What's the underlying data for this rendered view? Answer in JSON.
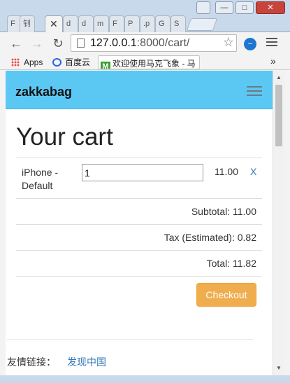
{
  "browser": {
    "tabs": [
      "F",
      "钊",
      "",
      "d",
      "d",
      "m",
      "F",
      "P",
      ".p",
      "G",
      "S"
    ],
    "address_host": "127.0.0.1",
    "address_rest": ":8000/cart/",
    "window_buttons": {
      "minimize": "—",
      "maximize": "□",
      "close": "✕"
    },
    "bookmarks": {
      "apps_label": "Apps",
      "baidu_label": "百度云",
      "tab_label": "欢迎使用马克飞象 - 马",
      "tab_icon_letter": "M",
      "more_label": "»"
    }
  },
  "site": {
    "brand": "zakkabag"
  },
  "cart": {
    "title": "Your cart",
    "item": {
      "name_line1": "iPhone -",
      "name_line2": "Default",
      "quantity": "1",
      "price": "11.00",
      "remove_label": "X"
    },
    "subtotal": "Subtotal: 11.00",
    "tax": "Tax (Estimated): 0.82",
    "total": "Total: 11.82",
    "checkout_label": "Checkout"
  },
  "footer": {
    "label": "友情链接：",
    "link": "发现中国"
  },
  "colors": {
    "navbar": "#5bc8f3",
    "checkout": "#f0ad4e",
    "link": "#337ab7"
  }
}
